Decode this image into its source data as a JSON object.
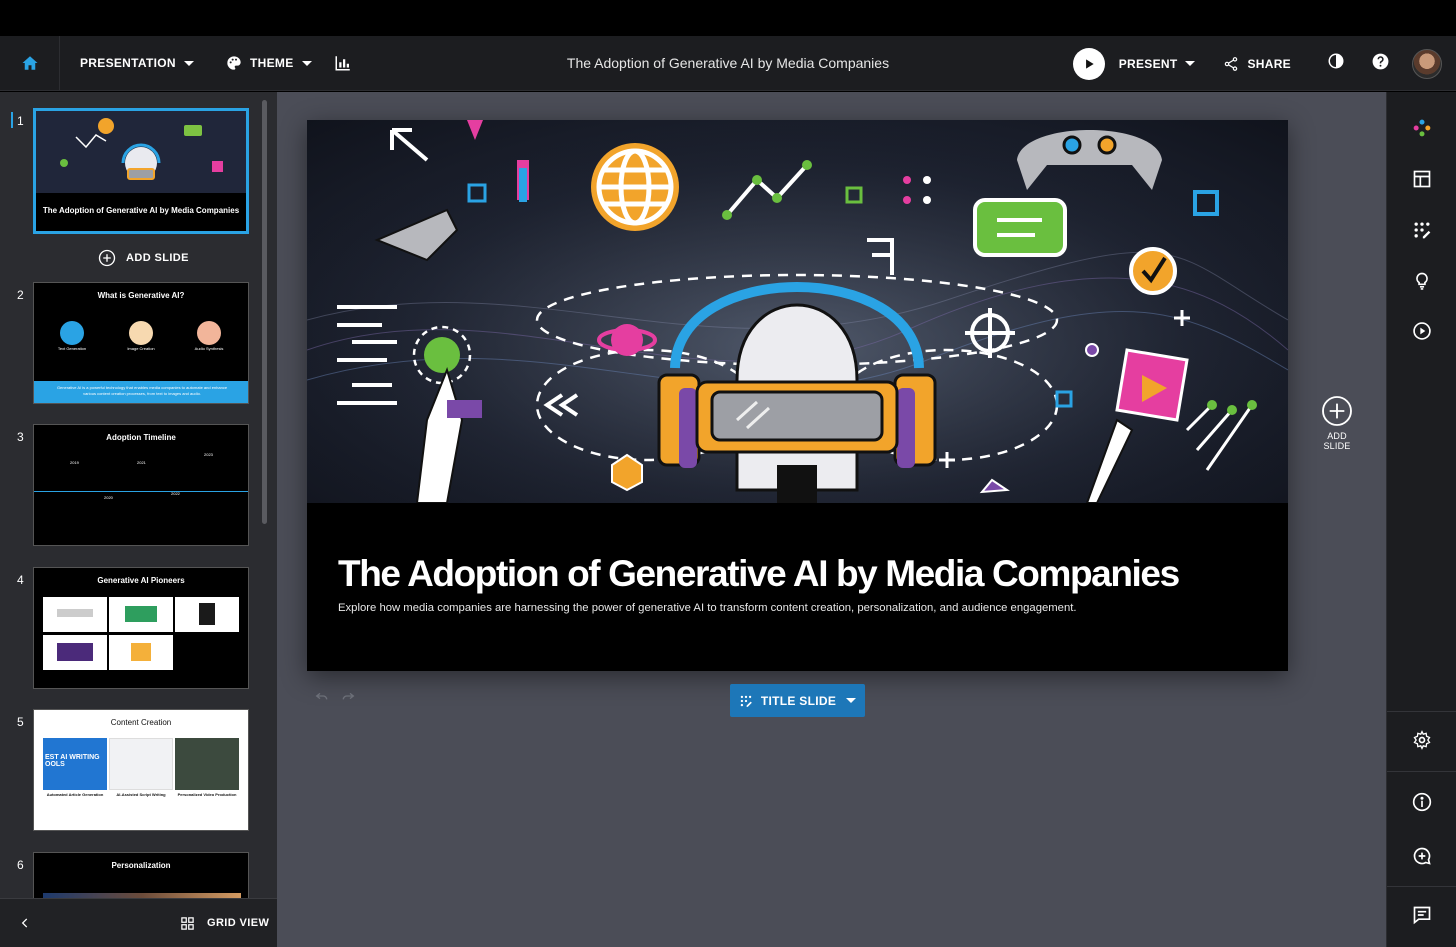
{
  "topbar": {
    "presentation_label": "PRESENTATION",
    "theme_label": "THEME",
    "doc_title": "The Adoption of Generative AI by Media Companies",
    "present_label": "PRESENT",
    "share_label": "SHARE"
  },
  "sidebar": {
    "add_slide_label": "ADD SLIDE",
    "grid_view_label": "GRID VIEW",
    "slides": [
      {
        "num": "1",
        "title": "The Adoption of Generative AI by Media Companies"
      },
      {
        "num": "2",
        "title": "What is Generative AI?",
        "cards": [
          "Text Generation",
          "Image Creation",
          "Audio Synthesis"
        ],
        "footer": "Generative AI is a powerful technology that enables media companies to automate and enhance various content creation processes, from text to images and audio."
      },
      {
        "num": "3",
        "title": "Adoption Timeline",
        "years": [
          "2019",
          "2020",
          "2021",
          "2022",
          "2023"
        ]
      },
      {
        "num": "4",
        "title": "Generative AI Pioneers"
      },
      {
        "num": "5",
        "title": "Content Creation",
        "captions": [
          "Automated Article Generation",
          "AI-Assisted Script Writing",
          "Personalized Video Production"
        ],
        "image_text": "EST AI WRITING OOLS"
      },
      {
        "num": "6",
        "title": "Personalization"
      }
    ]
  },
  "slide": {
    "title": "The Adoption of Generative AI by Media Companies",
    "subtitle": "Explore how media companies are harnessing the power of generative AI to transform content creation, personalization, and audience engagement."
  },
  "canvas": {
    "layout_label": "TITLE SLIDE",
    "add_slide_label": "ADD SLIDE"
  },
  "colors": {
    "accent": "#2aa3e4",
    "layout_button": "#1d77b8",
    "canvas_bg": "#4b4d57",
    "sidebar_bg": "#2b2c30",
    "topbar_bg": "#1c1d20"
  }
}
